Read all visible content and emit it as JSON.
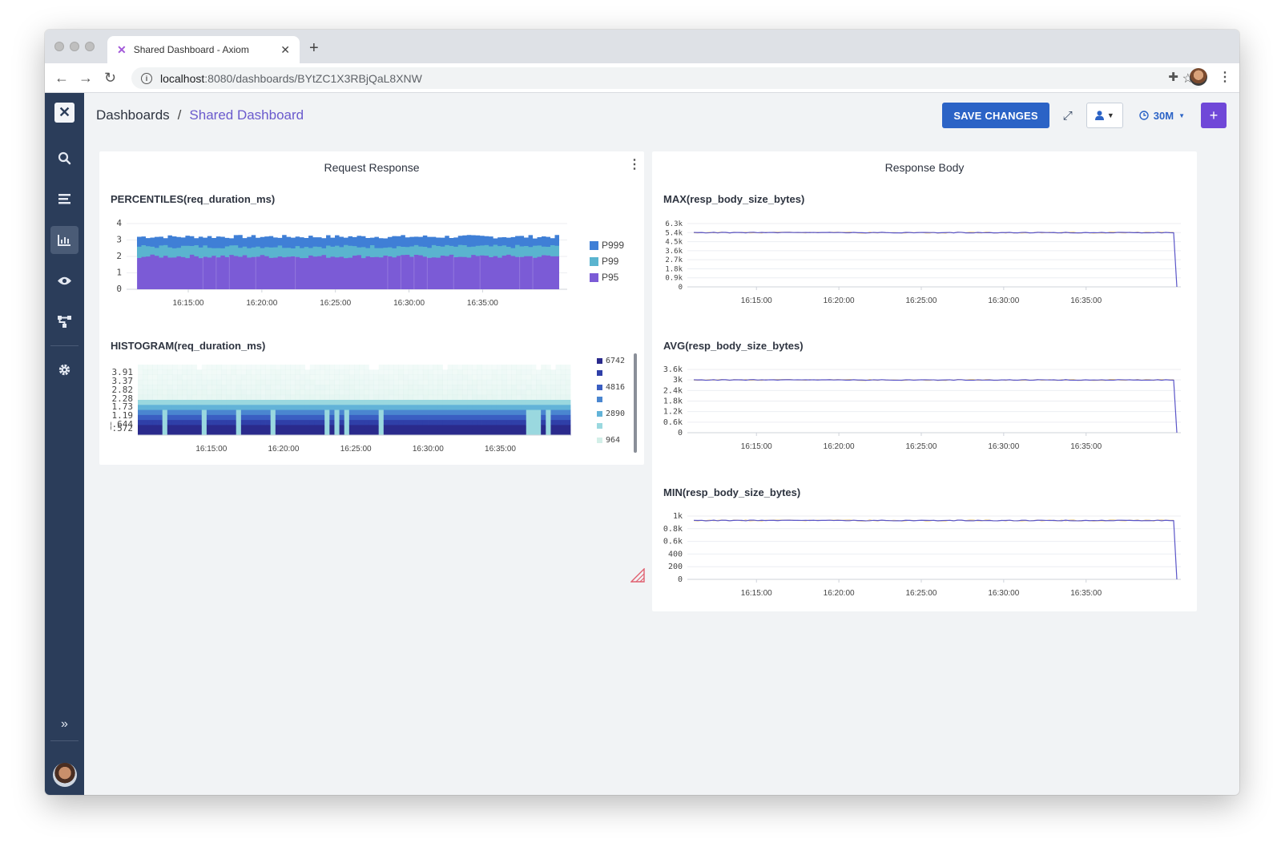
{
  "browser": {
    "tab_title": "Shared Dashboard - Axiom",
    "url_host": "localhost",
    "url_path": ":8080/dashboards/BYtZC1X3RBjQaL8XNW"
  },
  "header": {
    "breadcrumb_root": "Dashboards",
    "breadcrumb_sep": "/",
    "breadcrumb_current": "Shared Dashboard",
    "save_label": "SAVE CHANGES",
    "time_range": "30M"
  },
  "panels": {
    "left": {
      "title": "Request Response"
    },
    "right": {
      "title": "Response Body"
    }
  },
  "chart_titles": {
    "percentiles": "PERCENTILES(req_duration_ms)",
    "histogram": "HISTOGRAM(req_duration_ms)",
    "max": "MAX(resp_body_size_bytes)",
    "avg": "AVG(resp_body_size_bytes)",
    "min": "MIN(resp_body_size_bytes)"
  },
  "colors": {
    "accent": "#2b63c6",
    "purple": "#7048d8",
    "sidebar": "#2b3d5a",
    "p999": "#3f7fd6",
    "p99": "#5ab4cf",
    "p95": "#7b5bd6"
  },
  "chart_data": [
    {
      "id": "percentiles",
      "type": "area",
      "title": "PERCENTILES(req_duration_ms)",
      "x_ticks": [
        "16:15:00",
        "16:20:00",
        "16:25:00",
        "16:30:00",
        "16:35:00"
      ],
      "y_ticks": [
        "4",
        "3",
        "2",
        "1",
        "0"
      ],
      "ylim": [
        0,
        4
      ],
      "stacked": true,
      "series": [
        {
          "name": "P95",
          "level": 2.0,
          "color": "#7b5bd6"
        },
        {
          "name": "P99",
          "level": 2.6,
          "color": "#5ab4cf"
        },
        {
          "name": "P999",
          "level": 3.2,
          "color": "#3f7fd6"
        }
      ],
      "legend_position": "right"
    },
    {
      "id": "histogram",
      "type": "heatmap",
      "title": "HISTOGRAM(req_duration_ms)",
      "x_ticks": [
        "16:15:00",
        "16:20:00",
        "16:25:00",
        "16:30:00",
        "16:35:00"
      ],
      "y_ticks": [
        "3.91",
        "3.37",
        "2.82",
        "2.28",
        "1.73",
        "1.19",
        "0.644",
        "0.572"
      ],
      "legend": [
        "6742",
        "",
        "4816",
        "",
        "2890",
        "",
        "964"
      ],
      "legend_colors": [
        "#2a2a8c",
        "#2f3fa8",
        "#3a5ec2",
        "#4a86d0",
        "#62b3d8",
        "#9ad8df",
        "#d3efe8"
      ]
    },
    {
      "id": "max",
      "type": "line",
      "title": "MAX(resp_body_size_bytes)",
      "x_ticks": [
        "16:15:00",
        "16:20:00",
        "16:25:00",
        "16:30:00",
        "16:35:00"
      ],
      "y_ticks": [
        "6.3k",
        "5.4k",
        "4.5k",
        "3.6k",
        "2.7k",
        "1.8k",
        "0.9k",
        "0"
      ],
      "ylim": [
        0,
        6300
      ],
      "value": 5400,
      "final_value": 0
    },
    {
      "id": "avg",
      "type": "line",
      "title": "AVG(resp_body_size_bytes)",
      "x_ticks": [
        "16:15:00",
        "16:20:00",
        "16:25:00",
        "16:30:00",
        "16:35:00"
      ],
      "y_ticks": [
        "3.6k",
        "3k",
        "2.4k",
        "1.8k",
        "1.2k",
        "0.6k",
        "0"
      ],
      "ylim": [
        0,
        3600
      ],
      "value": 3000,
      "final_value": 0
    },
    {
      "id": "min",
      "type": "line",
      "title": "MIN(resp_body_size_bytes)",
      "x_ticks": [
        "16:15:00",
        "16:20:00",
        "16:25:00",
        "16:30:00",
        "16:35:00"
      ],
      "y_ticks": [
        "1k",
        "0.8k",
        "0.6k",
        "400",
        "200",
        "0"
      ],
      "ylim": [
        0,
        1000
      ],
      "value": 930,
      "final_value": 0
    }
  ]
}
